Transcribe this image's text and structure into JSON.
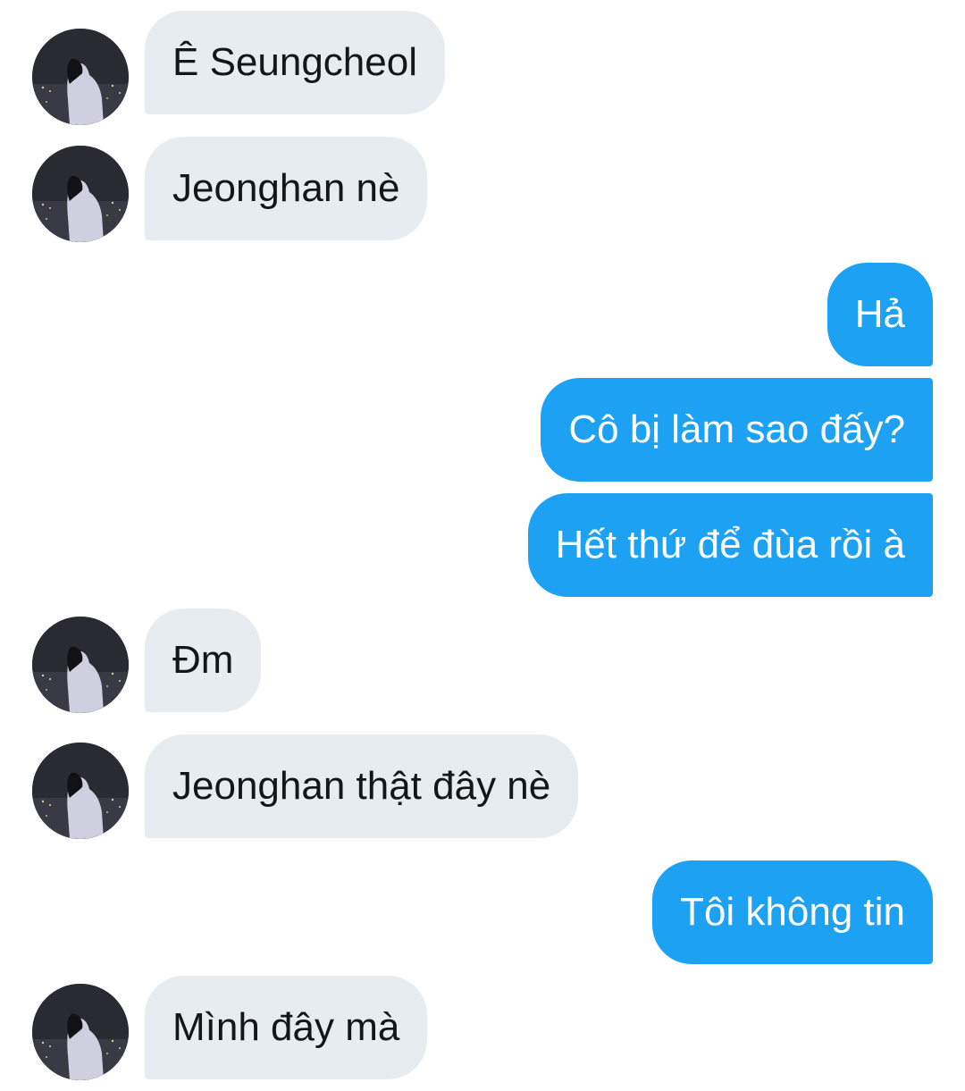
{
  "conversation": {
    "messages": [
      {
        "side": "in",
        "text": "Ê Seungcheol"
      },
      {
        "side": "in",
        "text": "Jeonghan nè"
      },
      {
        "side": "out",
        "text": "Hả"
      },
      {
        "side": "out",
        "text": "Cô bị làm sao đấy?"
      },
      {
        "side": "out",
        "text": "Hết thứ để đùa rồi à"
      },
      {
        "side": "in",
        "text": "Đm"
      },
      {
        "side": "in",
        "text": "Jeonghan thật đây nè"
      },
      {
        "side": "out",
        "text": "Tôi không tin"
      },
      {
        "side": "in",
        "text": "Mình đây mà"
      }
    ]
  },
  "colors": {
    "incoming_bubble": "#e6ecf0",
    "outgoing_bubble": "#1da1f2",
    "incoming_text": "#14171a",
    "outgoing_text": "#ffffff"
  },
  "icons": {
    "avatar": "contact-avatar-photo"
  }
}
